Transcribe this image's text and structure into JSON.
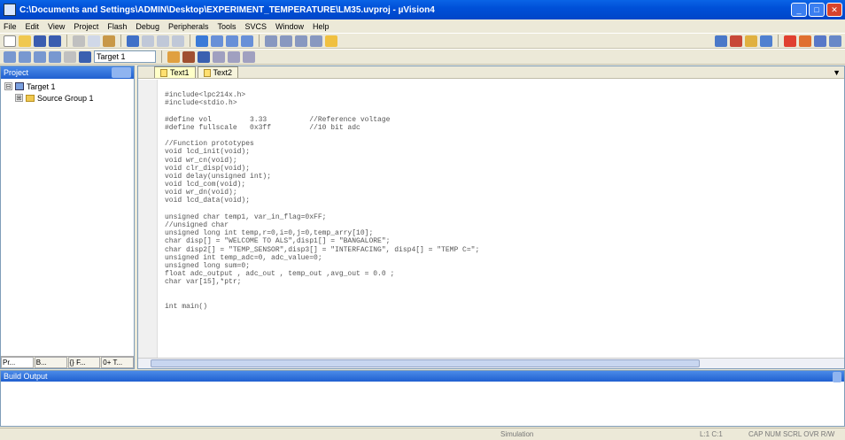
{
  "window": {
    "title": "C:\\Documents and Settings\\ADMIN\\Desktop\\EXPERIMENT_TEMPERATURE\\LM35.uvproj - µVision4",
    "controls": [
      "_",
      "□",
      "✕"
    ]
  },
  "menu": [
    "File",
    "Edit",
    "View",
    "Project",
    "Flash",
    "Debug",
    "Peripherals",
    "Tools",
    "SVCS",
    "Window",
    "Help"
  ],
  "toolbar2": {
    "target": "Target 1"
  },
  "project_panel": {
    "title": "Project",
    "tree": [
      {
        "label": "Target 1",
        "expander": "⊟"
      },
      {
        "label": "Source Group 1",
        "expander": "⊞"
      }
    ],
    "tabs": [
      "Pr...",
      "B...",
      "{} F...",
      "0+ T..."
    ]
  },
  "editor": {
    "tabs": [
      {
        "label": "Text1",
        "active": true
      },
      {
        "label": "Text2",
        "active": false
      }
    ],
    "code_lines": [
      "#include<lpc214x.h>",
      "#include<stdio.h>",
      "",
      "#define vol         3.33          //Reference voltage",
      "#define fullscale   0x3ff         //10 bit adc",
      "",
      "//Function prototypes",
      "void lcd_init(void);",
      "void wr_cn(void);",
      "void clr_disp(void);",
      "void delay(unsigned int);",
      "void lcd_com(void);",
      "void wr_dn(void);",
      "void lcd_data(void);",
      "",
      "unsigned char temp1, var_in_flag=0xFF;",
      "//unsigned char",
      "unsigned long int temp,r=0,i=0,j=0,temp_arry[10];",
      "char disp[] = \"WELCOME TO ALS\",disp1[] = \"BANGALORE\";",
      "char disp2[] = \"TEMP_SENSOR\",disp3[] = \"INTERFACING\", disp4[] = \"TEMP C=\";",
      "unsigned int temp_adc=0, adc_value=0;",
      "unsigned long sum=0;",
      "float adc_output , adc_out , temp_out ,avg_out = 0.0 ;",
      "char var[15],*ptr;",
      "",
      "",
      "int main()"
    ]
  },
  "output_panel": {
    "title": "Build Output"
  },
  "status": {
    "debugger": "Simulation",
    "position": "L:1 C:1",
    "mode": "CAP  NUM  SCRL  OVR  R/W"
  }
}
